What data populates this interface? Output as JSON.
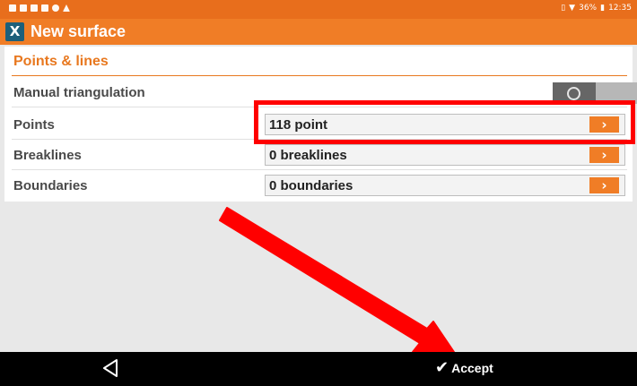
{
  "status_bar": {
    "right_text": "36%",
    "time": "12:35",
    "icons": [
      "notification-icon",
      "notification-icon",
      "notification-icon",
      "notification-icon",
      "notification-icon",
      "warning-icon",
      "vibrate-icon",
      "wifi-icon",
      "battery-icon"
    ]
  },
  "header": {
    "logo_glyph": "X",
    "title": "New surface"
  },
  "section": {
    "title": "Points & lines"
  },
  "rows": {
    "manual_triangulation": {
      "label": "Manual triangulation",
      "toggle_on": false
    },
    "points": {
      "label": "Points",
      "value": "118 point",
      "arrow": "›"
    },
    "breaklines": {
      "label": "Breaklines",
      "value": "0 breaklines",
      "arrow": "›"
    },
    "boundaries": {
      "label": "Boundaries",
      "value": "0 boundaries",
      "arrow": "›"
    }
  },
  "nav": {
    "accept_label": "Accept",
    "check_glyph": "✔"
  },
  "colors": {
    "status_bar": "#e86e1c",
    "title_bar": "#f07d26",
    "section_title": "#e8781f",
    "highlight": "#ff0000",
    "nav_bar": "#000000"
  }
}
